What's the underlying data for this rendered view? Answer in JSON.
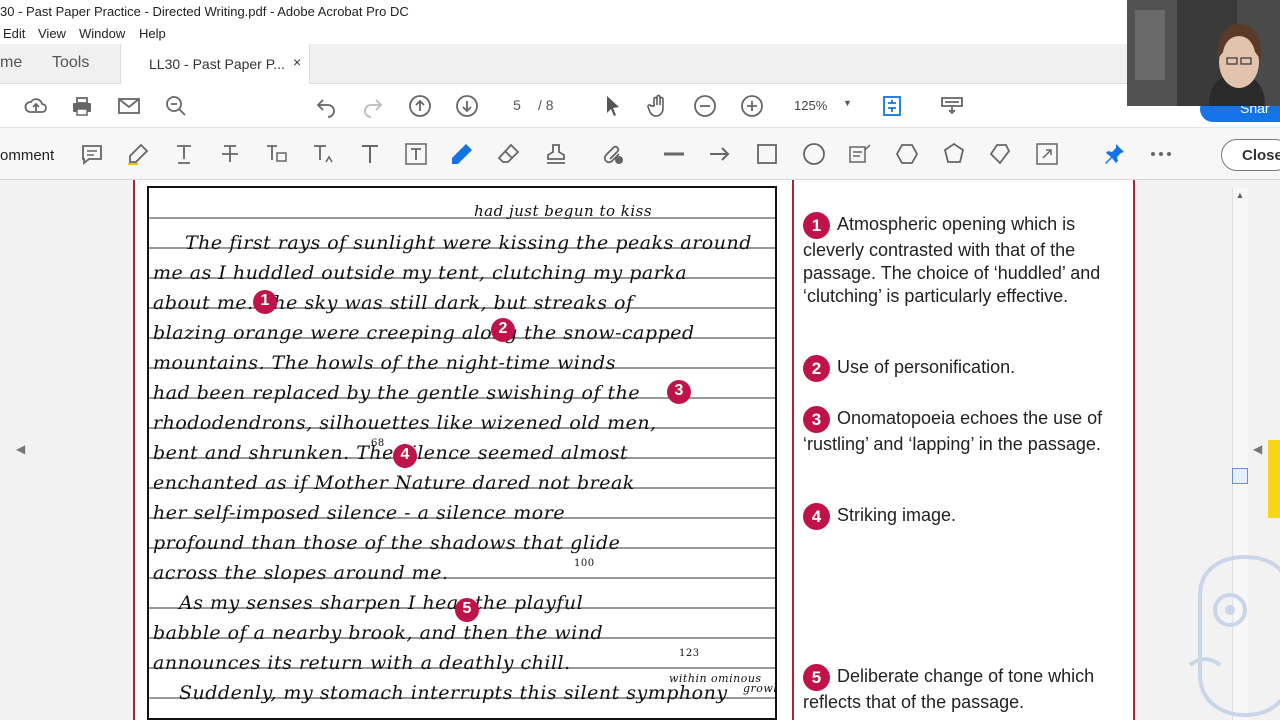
{
  "window": {
    "title": "30 - Past Paper Practice - Directed Writing.pdf - Adobe Acrobat Pro DC"
  },
  "menu": [
    "Edit",
    "View",
    "Window",
    "Help"
  ],
  "tabs": {
    "home": "me",
    "tools": "Tools",
    "document": "LL30 - Past Paper P...",
    "close": "×"
  },
  "toolbar": {
    "page_current": "5",
    "page_total": "/ 8",
    "zoom": "125%"
  },
  "comment_toolbar": {
    "label": "omment",
    "close_label": "Close"
  },
  "share": {
    "label": "Shar"
  },
  "scan": {
    "lines": [
      "had just begun to kiss",
      "The first rays of sunlight were kissing the peaks around",
      "me as I huddled outside my tent, clutching my parka",
      "about me. The sky was still dark, but streaks of",
      "blazing orange were creeping along the snow-capped",
      "mountains. The howls of the night-time winds",
      "had been replaced by the gentle swishing of the",
      "rhododendrons, silhouettes like wizened old men,",
      "bent and shrunken. The silence seemed almost",
      "enchanted as if Mother Nature dared not break",
      "her self-imposed silence - a silence more",
      "profound than those of the shadows that glide",
      "across the slopes around me.",
      "As my senses sharpen I hear the playful",
      "babble of a nearby brook, and then the wind",
      "announces its return with a deathly chill.",
      "Suddenly, my stomach interrupts this silent symphony"
    ],
    "margin_marks": [
      "68",
      "100",
      "123",
      "within ominous",
      "growl"
    ],
    "markers": [
      "1",
      "2",
      "3",
      "4",
      "5"
    ]
  },
  "notes": [
    {
      "num": "1",
      "text": "Atmospheric opening which is cleverly contrasted with that of the passage. The choice of ‘huddled’ and ‘clutching’ is particularly effective."
    },
    {
      "num": "2",
      "text": "Use of personification."
    },
    {
      "num": "3",
      "text": "Onomatopoeia echoes the use of ‘rustling’ and ‘lapping’ in the passage."
    },
    {
      "num": "4",
      "text": "Striking image."
    },
    {
      "num": "5",
      "text": "Deliberate change of tone which reflects that of the passage."
    }
  ],
  "colors": {
    "accent": "#c0134a",
    "border": "#b0213f",
    "share": "#1473e6"
  }
}
